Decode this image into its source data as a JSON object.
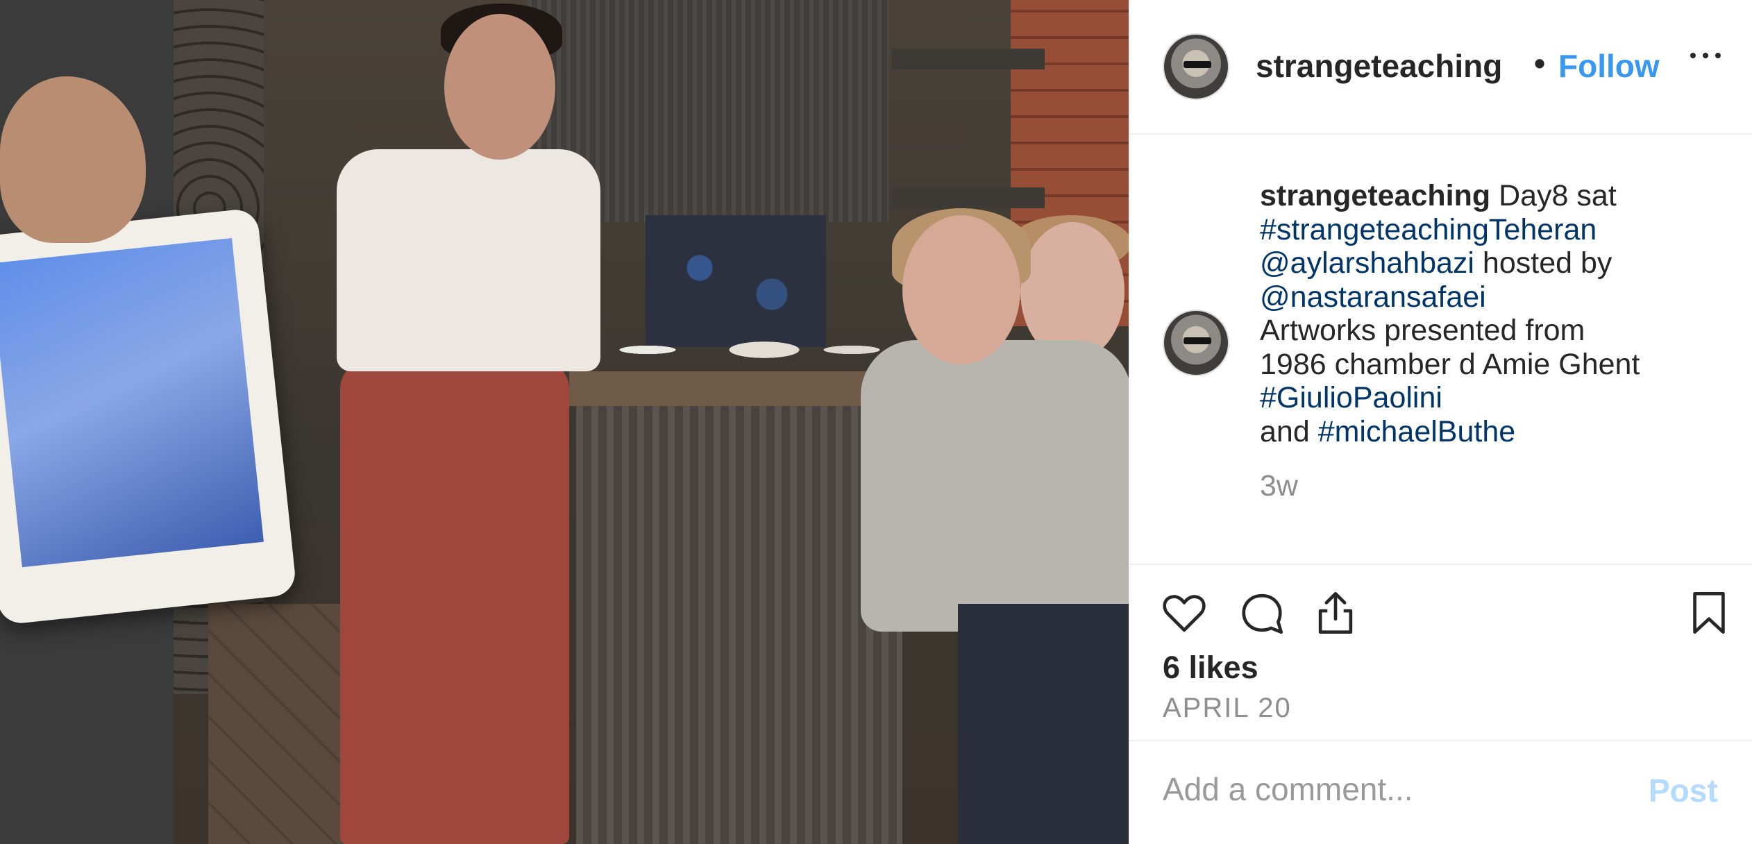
{
  "post": {
    "username": "strangeteaching",
    "dot": "•",
    "follow_label": "Follow",
    "more_icon": "more-horizontal-icon"
  },
  "caption": {
    "username": "strangeteaching",
    "line1_text": " Day8 sat",
    "line2_tag": "#strangeteachingTeheran",
    "line3_mention": "@aylarshahbazi",
    "line3_text": " hosted by",
    "line4_mention": "@nastaransafaei",
    "line5_text": "Artworks presented from",
    "line6_text": "1986 chamber d Amie Ghent",
    "line7_tag": "#GiulioPaolini",
    "line8_text": "and ",
    "line8_tag": "#michaelButhe",
    "age": "3w"
  },
  "actions": {
    "like_icon": "heart-icon",
    "comment_icon": "comment-bubble-icon",
    "share_icon": "share-upload-icon",
    "save_icon": "bookmark-icon"
  },
  "likes": "6 likes",
  "date": "APRIL 20",
  "comment": {
    "placeholder": "Add a comment...",
    "post_label": "Post"
  },
  "colors": {
    "link_blue": "#3897f0",
    "hashtag_blue": "#003569",
    "muted": "#8e8e8e",
    "post_disabled": "#b3dbff"
  }
}
